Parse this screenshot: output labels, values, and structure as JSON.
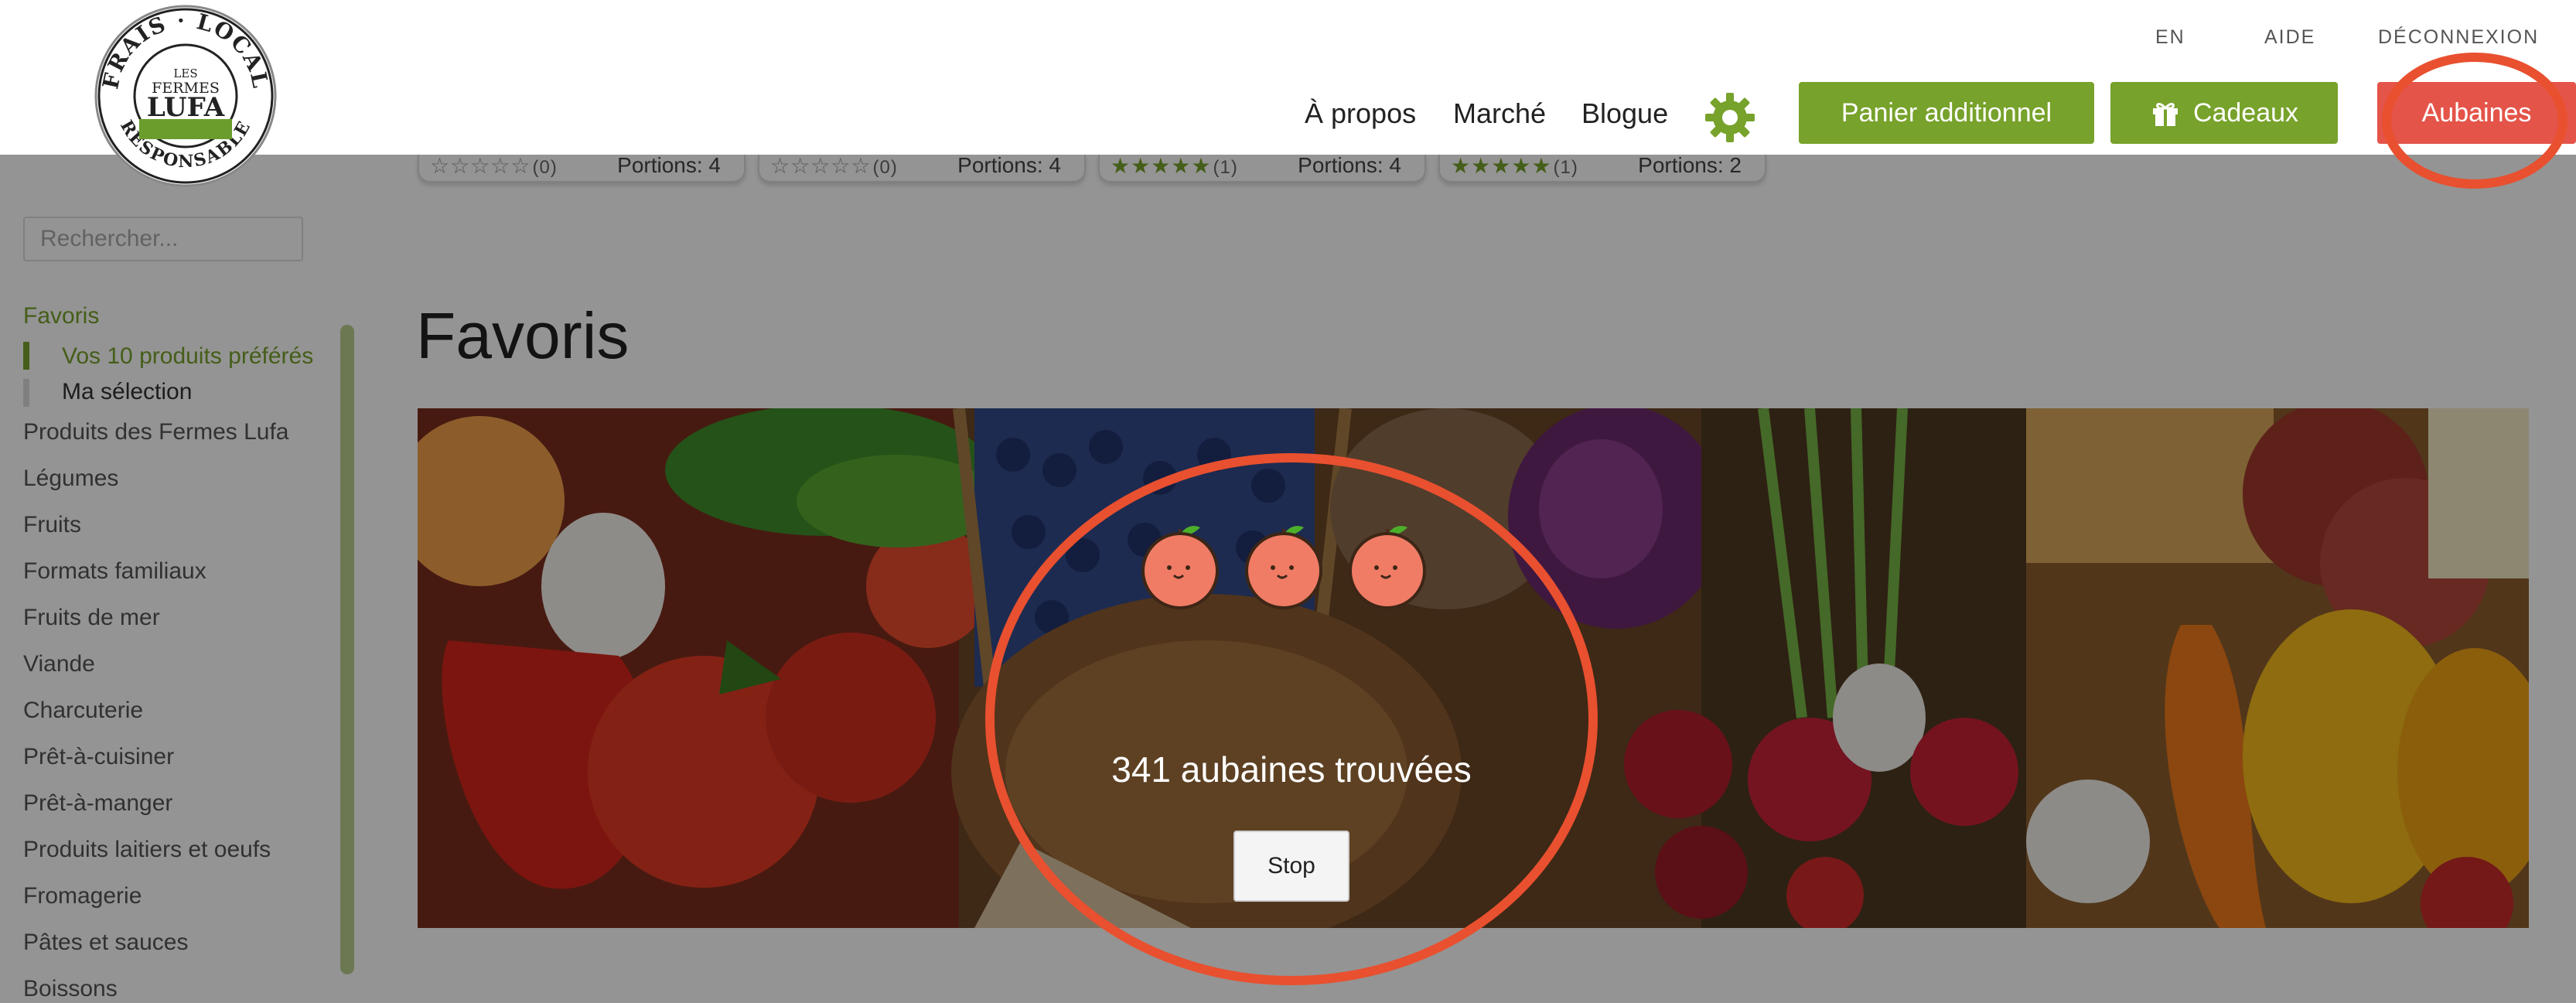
{
  "topbar": {
    "links": [
      "EN",
      "AIDE",
      "DÉCONNEXION"
    ]
  },
  "logo": {
    "ring_top": "FRAIS · LOCAL",
    "ring_bottom": "RESPONSABLE",
    "line1": "LES",
    "line2": "FERMES",
    "line3": "LUFA"
  },
  "nav": {
    "links": [
      "À propos",
      "Marché",
      "Blogue"
    ],
    "settings_icon": "gear-icon",
    "extra_basket": "Panier additionnel",
    "gifts": "Cadeaux",
    "gifts_icon": "gift-icon",
    "deals": "Aubaines"
  },
  "recipe_cards": [
    {
      "rating_count": "(0)",
      "portions": "Portions: 4",
      "filled": false
    },
    {
      "rating_count": "(0)",
      "portions": "Portions: 4",
      "filled": false
    },
    {
      "rating_count": "(1)",
      "portions": "Portions: 4",
      "filled": true
    },
    {
      "rating_count": "(1)",
      "portions": "Portions: 2",
      "filled": true
    }
  ],
  "sidebar": {
    "search_placeholder": "Rechercher...",
    "favorites": "Favoris",
    "favorites_sub": [
      "Vos 10 produits préférés",
      "Ma sélection"
    ],
    "categories": [
      "Produits des Fermes Lufa",
      "Légumes",
      "Fruits",
      "Formats familiaux",
      "Fruits de mer",
      "Viande",
      "Charcuterie",
      "Prêt-à-cuisiner",
      "Prêt-à-manger",
      "Produits laitiers et oeufs",
      "Fromagerie",
      "Pâtes et sauces",
      "Boissons"
    ]
  },
  "main": {
    "title": "Favoris"
  },
  "search_overlay": {
    "found_text": "341 aubaines trouvées",
    "stop_label": "Stop"
  },
  "colors": {
    "brand_green": "#77a22b",
    "deals_red": "#e45449",
    "annotation": "#e8502f",
    "peach": "#f07c66"
  }
}
